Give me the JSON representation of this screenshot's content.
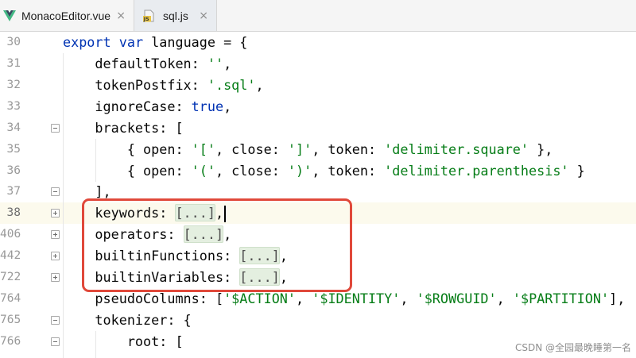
{
  "theme": {
    "editor_bg": "#ffffff",
    "tabbar_bg": "#f5f5f5",
    "active_tab_bg": "#e9ecf0",
    "border": "#d6d6d6",
    "line_number": "#999999",
    "current_line_bg": "#fcfaed",
    "plain": "#080808",
    "indent_guide": "#e6e6e6",
    "annotation": "#e0483a",
    "vue_green": "#41b883",
    "vue_dark": "#35495e",
    "js_yellow": "#e8c547"
  },
  "tabs": [
    {
      "label": "MonacoEditor.vue",
      "icon": "vue-icon",
      "active": false,
      "close": "×"
    },
    {
      "label": "sql.js",
      "icon": "js-file-icon",
      "icon_text": "JS",
      "active": true,
      "close": "×"
    }
  ],
  "editor": {
    "lines": [
      {
        "number": "30",
        "fold_icon": null,
        "tokens": [
          {
            "text": "export",
            "color": "#0033b3"
          },
          {
            "text": " ",
            "color": "#080808"
          },
          {
            "text": "var",
            "color": "#0033b3"
          },
          {
            "text": " language = {",
            "color": "#080808"
          }
        ]
      },
      {
        "number": "31",
        "fold_icon": null,
        "tokens": [
          {
            "text": "    defaultToken: ",
            "color": "#080808"
          },
          {
            "text": "''",
            "color": "#067d17"
          },
          {
            "text": ",",
            "color": "#080808"
          }
        ]
      },
      {
        "number": "32",
        "fold_icon": null,
        "tokens": [
          {
            "text": "    tokenPostfix: ",
            "color": "#080808"
          },
          {
            "text": "'.sql'",
            "color": "#067d17"
          },
          {
            "text": ",",
            "color": "#080808"
          }
        ]
      },
      {
        "number": "33",
        "fold_icon": null,
        "tokens": [
          {
            "text": "    ignoreCase: ",
            "color": "#080808"
          },
          {
            "text": "true",
            "color": "#0033b3"
          },
          {
            "text": ",",
            "color": "#080808"
          }
        ]
      },
      {
        "number": "34",
        "fold_icon": "fold-open-icon",
        "tokens": [
          {
            "text": "    brackets: [",
            "color": "#080808"
          }
        ]
      },
      {
        "number": "35",
        "fold_icon": null,
        "tokens": [
          {
            "text": "        { open: ",
            "color": "#080808"
          },
          {
            "text": "'['",
            "color": "#067d17"
          },
          {
            "text": ", close: ",
            "color": "#080808"
          },
          {
            "text": "']'",
            "color": "#067d17"
          },
          {
            "text": ", token: ",
            "color": "#080808"
          },
          {
            "text": "'delimiter.square'",
            "color": "#067d17"
          },
          {
            "text": " },",
            "color": "#080808"
          }
        ]
      },
      {
        "number": "36",
        "fold_icon": null,
        "tokens": [
          {
            "text": "        { open: ",
            "color": "#080808"
          },
          {
            "text": "'('",
            "color": "#067d17"
          },
          {
            "text": ", close: ",
            "color": "#080808"
          },
          {
            "text": "')'",
            "color": "#067d17"
          },
          {
            "text": ", token: ",
            "color": "#080808"
          },
          {
            "text": "'delimiter.parenthesis'",
            "color": "#067d17"
          },
          {
            "text": " }",
            "color": "#080808"
          }
        ]
      },
      {
        "number": "37",
        "fold_icon": "fold-end-icon",
        "tokens": [
          {
            "text": "    ],",
            "color": "#080808"
          }
        ]
      },
      {
        "number": "38",
        "fold_icon": "fold-collapsed-icon",
        "current": true,
        "caret": true,
        "tokens": [
          {
            "text": "    keywords: ",
            "color": "#080808"
          },
          {
            "text": "[...]",
            "color": "#4d4d4d",
            "highlight": "#e4efe0"
          },
          {
            "text": ",",
            "color": "#080808"
          }
        ]
      },
      {
        "number": "406",
        "fold_icon": "fold-collapsed-icon",
        "tokens": [
          {
            "text": "    operators: ",
            "color": "#080808"
          },
          {
            "text": "[...]",
            "color": "#4d4d4d",
            "highlight": "#e4efe0"
          },
          {
            "text": ",",
            "color": "#080808"
          }
        ]
      },
      {
        "number": "442",
        "fold_icon": "fold-collapsed-icon",
        "tokens": [
          {
            "text": "    builtinFunctions: ",
            "color": "#080808"
          },
          {
            "text": "[...]",
            "color": "#4d4d4d",
            "highlight": "#e4efe0"
          },
          {
            "text": ",",
            "color": "#080808"
          }
        ]
      },
      {
        "number": "722",
        "fold_icon": "fold-collapsed-icon",
        "tokens": [
          {
            "text": "    builtinVariables: ",
            "color": "#080808"
          },
          {
            "text": "[...]",
            "color": "#4d4d4d",
            "highlight": "#e4efe0"
          },
          {
            "text": ",",
            "color": "#080808"
          }
        ]
      },
      {
        "number": "764",
        "fold_icon": null,
        "tokens": [
          {
            "text": "    pseudoColumns: [",
            "color": "#080808"
          },
          {
            "text": "'$ACTION'",
            "color": "#067d17"
          },
          {
            "text": ", ",
            "color": "#080808"
          },
          {
            "text": "'$IDENTITY'",
            "color": "#067d17"
          },
          {
            "text": ", ",
            "color": "#080808"
          },
          {
            "text": "'$ROWGUID'",
            "color": "#067d17"
          },
          {
            "text": ", ",
            "color": "#080808"
          },
          {
            "text": "'$PARTITION'",
            "color": "#067d17"
          },
          {
            "text": "],",
            "color": "#080808"
          }
        ]
      },
      {
        "number": "765",
        "fold_icon": "fold-open-icon",
        "tokens": [
          {
            "text": "    tokenizer: {",
            "color": "#080808"
          }
        ]
      },
      {
        "number": "766",
        "fold_icon": "fold-open-icon",
        "tokens": [
          {
            "text": "        root: [",
            "color": "#080808"
          }
        ]
      }
    ]
  },
  "watermark": {
    "text": "CSDN @全园最晚睡第一名"
  }
}
